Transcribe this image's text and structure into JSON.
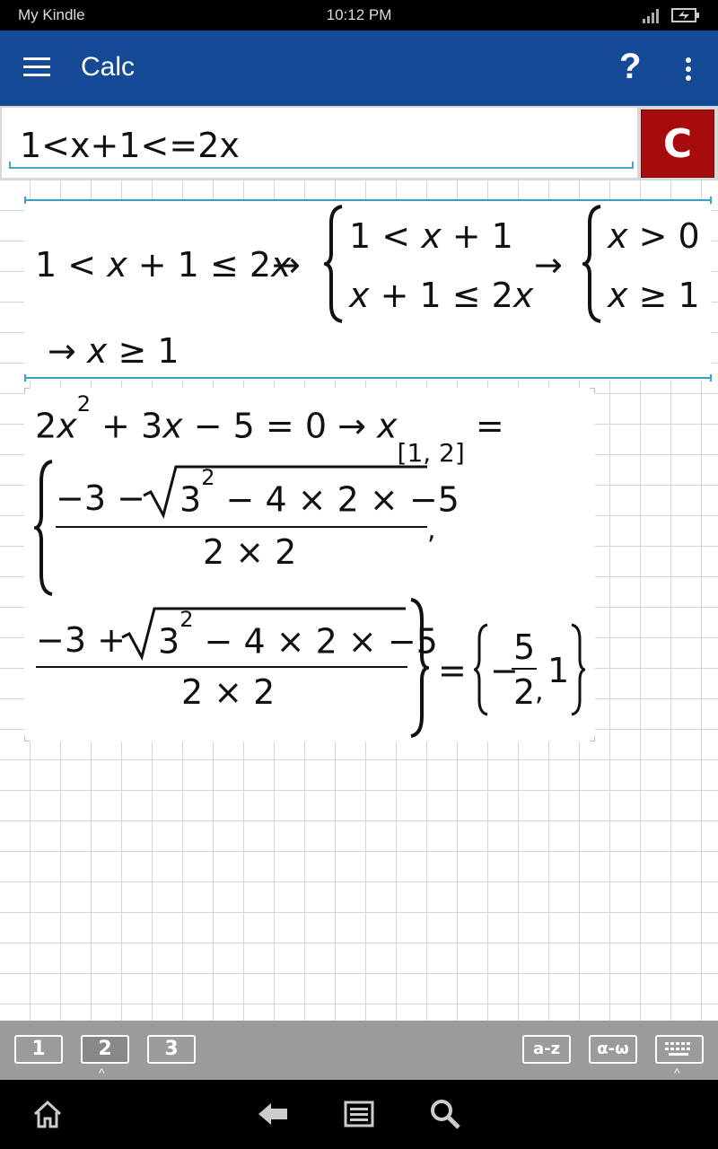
{
  "status_bar": {
    "left_text": "My Kindle",
    "time": "10:12 PM",
    "icons": [
      "signal-icon",
      "battery-charging-icon"
    ]
  },
  "app_bar": {
    "title": "Calc",
    "help_label": "?",
    "icons": [
      "menu-icon",
      "help-icon",
      "overflow-menu-icon"
    ]
  },
  "input": {
    "expression": "1<x+1<=2x",
    "clear_label": "C"
  },
  "results": [
    {
      "input_lhs": [
        "1 < ",
        "x",
        " + 1 ≤ 2",
        "x"
      ],
      "arrow": "→",
      "system1": [
        [
          "1 < ",
          "x",
          " + 1"
        ],
        [
          "x",
          " + 1 ≤ 2",
          "x"
        ]
      ],
      "system2": [
        [
          "x",
          " > 0"
        ],
        [
          "x",
          " ≥ 1"
        ]
      ],
      "conclusion": [
        "→ ",
        "x",
        " ≥ 1"
      ]
    },
    {
      "lhs": [
        "2",
        "x",
        "2",
        " + 3",
        "x",
        " − 5 = 0 → ",
        "x",
        "[1, 2]",
        " ="
      ],
      "root1": {
        "prefix": "−3 −",
        "radicand_base": "3",
        "radicand_exp": "2",
        "radicand_rest": " − 4 × 2 × −5",
        "denominator": "2 × 2"
      },
      "root2": {
        "prefix": "−3 +",
        "radicand_base": "3",
        "radicand_exp": "2",
        "radicand_rest": " − 4 × 2 × −5",
        "denominator": "2 × 2"
      },
      "separator": ",",
      "equals": "=",
      "solution": {
        "neg": "−",
        "num": "5",
        "den": "2",
        "comma": ",",
        "second": "1"
      }
    }
  ],
  "keyboard_toolbar": {
    "left_buttons": [
      "1",
      "2",
      "3"
    ],
    "right_buttons": [
      "a-z",
      "α-ω"
    ],
    "active_left": "2",
    "icons": [
      "keyboard-icon"
    ]
  },
  "nav_bar": {
    "icons": [
      "home-icon",
      "back-icon",
      "menu-list-icon",
      "search-icon"
    ]
  }
}
